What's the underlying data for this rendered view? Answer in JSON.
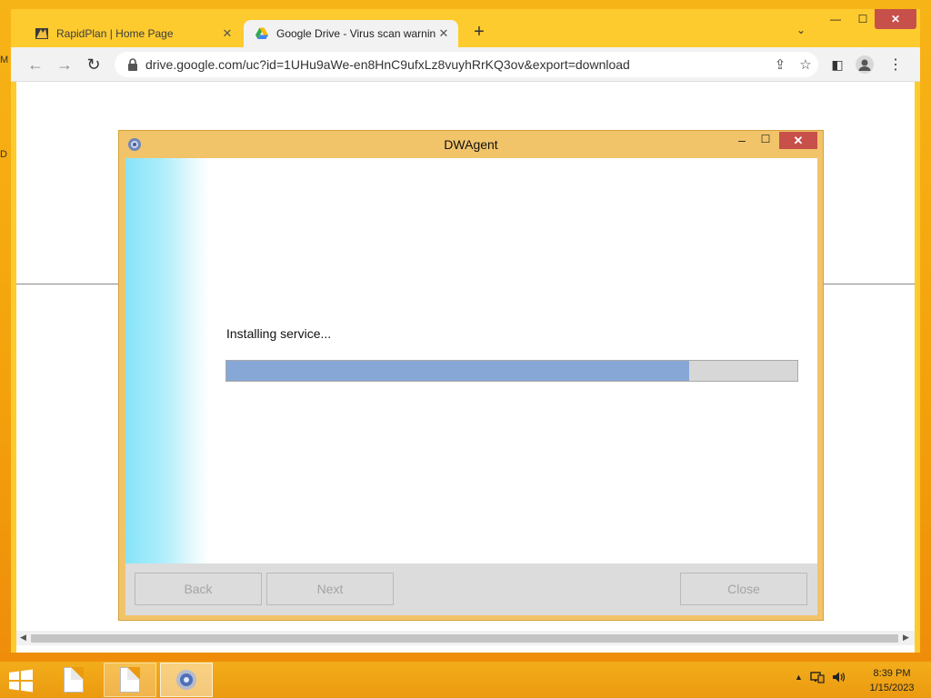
{
  "desktop": {
    "edge_label_top": "M",
    "edge_label_mid": "D"
  },
  "browser": {
    "tabs": [
      {
        "title": "RapidPlan | Home Page",
        "icon": "rapidplan-favicon",
        "active": false,
        "close": "✕"
      },
      {
        "title": "Google Drive - Virus scan warnin",
        "icon": "google-drive-icon",
        "active": true,
        "close": "✕"
      }
    ],
    "new_tab": "+",
    "tab_search": "⌄",
    "window_controls": {
      "minimize": "—",
      "maximize": "☐",
      "close": "✕"
    },
    "toolbar": {
      "back": "←",
      "forward": "→",
      "reload": "↻",
      "url": "drive.google.com/uc?id=1UHu9aWe-en8HnC9ufxLz8vuyhRrKQ3ov&export=download",
      "share": "⇪",
      "bookmark": "☆",
      "sidepanel": "◧",
      "menu": "⋮"
    },
    "scrollbar": {
      "left": "◀",
      "right": "▶"
    }
  },
  "dialog": {
    "title": "DWAgent",
    "controls": {
      "minimize": "–",
      "maximize": "☐",
      "close": "✕"
    },
    "status": "Installing service...",
    "progress_fraction": 0.81,
    "buttons": {
      "back": "Back",
      "next": "Next",
      "close": "Close"
    }
  },
  "taskbar": {
    "time": "8:39 PM",
    "date": "1/15/2023",
    "tray_chevron": "▲"
  },
  "colors": {
    "desktop": "#f4a20c",
    "browser_frame": "#fecb2f",
    "dialog_frame": "#f2c46a",
    "progress_fill": "#87a8d6",
    "close_red": "#c7504a"
  }
}
